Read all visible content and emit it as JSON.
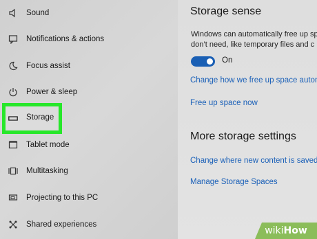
{
  "sidebar": {
    "items": [
      {
        "label": "Sound",
        "icon": "speaker-icon"
      },
      {
        "label": "Notifications & actions",
        "icon": "notification-icon"
      },
      {
        "label": "Focus assist",
        "icon": "moon-icon"
      },
      {
        "label": "Power & sleep",
        "icon": "power-icon"
      },
      {
        "label": "Storage",
        "icon": "storage-drive-icon",
        "selected": true
      },
      {
        "label": "Tablet mode",
        "icon": "tablet-icon"
      },
      {
        "label": "Multitasking",
        "icon": "multitasking-icon"
      },
      {
        "label": "Projecting to this PC",
        "icon": "projector-icon"
      },
      {
        "label": "Shared experiences",
        "icon": "shared-experiences-icon"
      }
    ]
  },
  "main": {
    "storage_sense": {
      "title": "Storage sense",
      "description_line1": "Windows can automatically free up sp",
      "description_line2": "don’t need, like temporary files and c",
      "toggle_label": "On",
      "toggle_on": true,
      "change_link": "Change how we free up space autom",
      "free_up_link": "Free up space now"
    },
    "more_settings": {
      "title": "More storage settings",
      "change_location_link": "Change where new content is saved",
      "manage_spaces_link": "Manage Storage Spaces"
    }
  },
  "watermark": {
    "brand": "wiki",
    "brand2": "How",
    "color": "#8bbd5a"
  },
  "colors": {
    "highlight": "#27e72a",
    "link": "#1a60b8",
    "toggle": "#1a5fb4"
  }
}
